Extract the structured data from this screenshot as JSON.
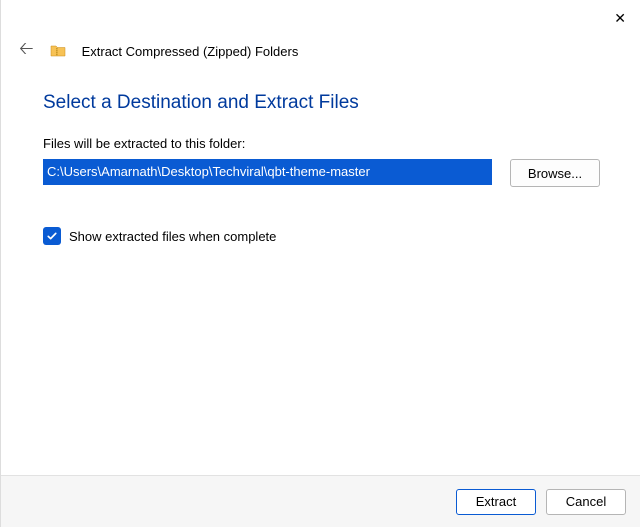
{
  "window": {
    "wizard_title": "Extract Compressed (Zipped) Folders"
  },
  "content": {
    "heading": "Select a Destination and Extract Files",
    "dest_label": "Files will be extracted to this folder:",
    "dest_value": "C:\\Users\\Amarnath\\Desktop\\Techviral\\qbt-theme-master",
    "browse_label": "Browse...",
    "show_extracted_label": "Show extracted files when complete",
    "show_extracted_checked": true
  },
  "footer": {
    "extract_label": "Extract",
    "cancel_label": "Cancel"
  }
}
